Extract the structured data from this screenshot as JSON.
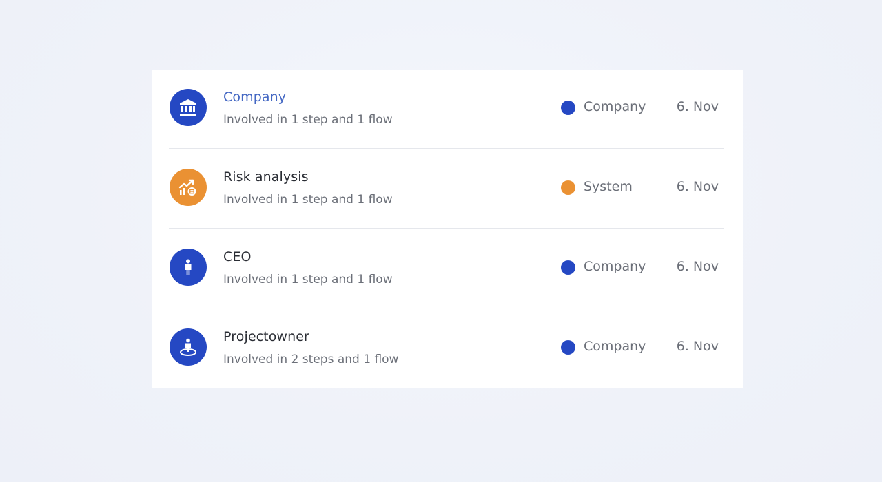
{
  "rows": [
    {
      "title": "Company",
      "subtitle": "Involved in 1 step and 1 flow",
      "type": "Company",
      "type_color": "#2548c3",
      "date": "6. Nov",
      "icon": "building-icon",
      "avatar_color": "#2548c3"
    },
    {
      "title": "Risk analysis",
      "subtitle": "Involved in 1 step and 1 flow",
      "type": "System",
      "type_color": "#ea9133",
      "date": "6. Nov",
      "icon": "chart-trend-icon",
      "avatar_color": "#ea9133"
    },
    {
      "title": "CEO",
      "subtitle": "Involved in 1 step and 1 flow",
      "type": "Company",
      "type_color": "#2548c3",
      "date": "6. Nov",
      "icon": "person-icon",
      "avatar_color": "#2548c3"
    },
    {
      "title": "Projectowner",
      "subtitle": "Involved in 2 steps and 1 flow",
      "type": "Company",
      "type_color": "#2548c3",
      "date": "6. Nov",
      "icon": "person-target-icon",
      "avatar_color": "#2548c3"
    }
  ],
  "colors": {
    "title_link": "#4367c3",
    "company_blue": "#2548c3",
    "system_orange": "#ea9133"
  }
}
